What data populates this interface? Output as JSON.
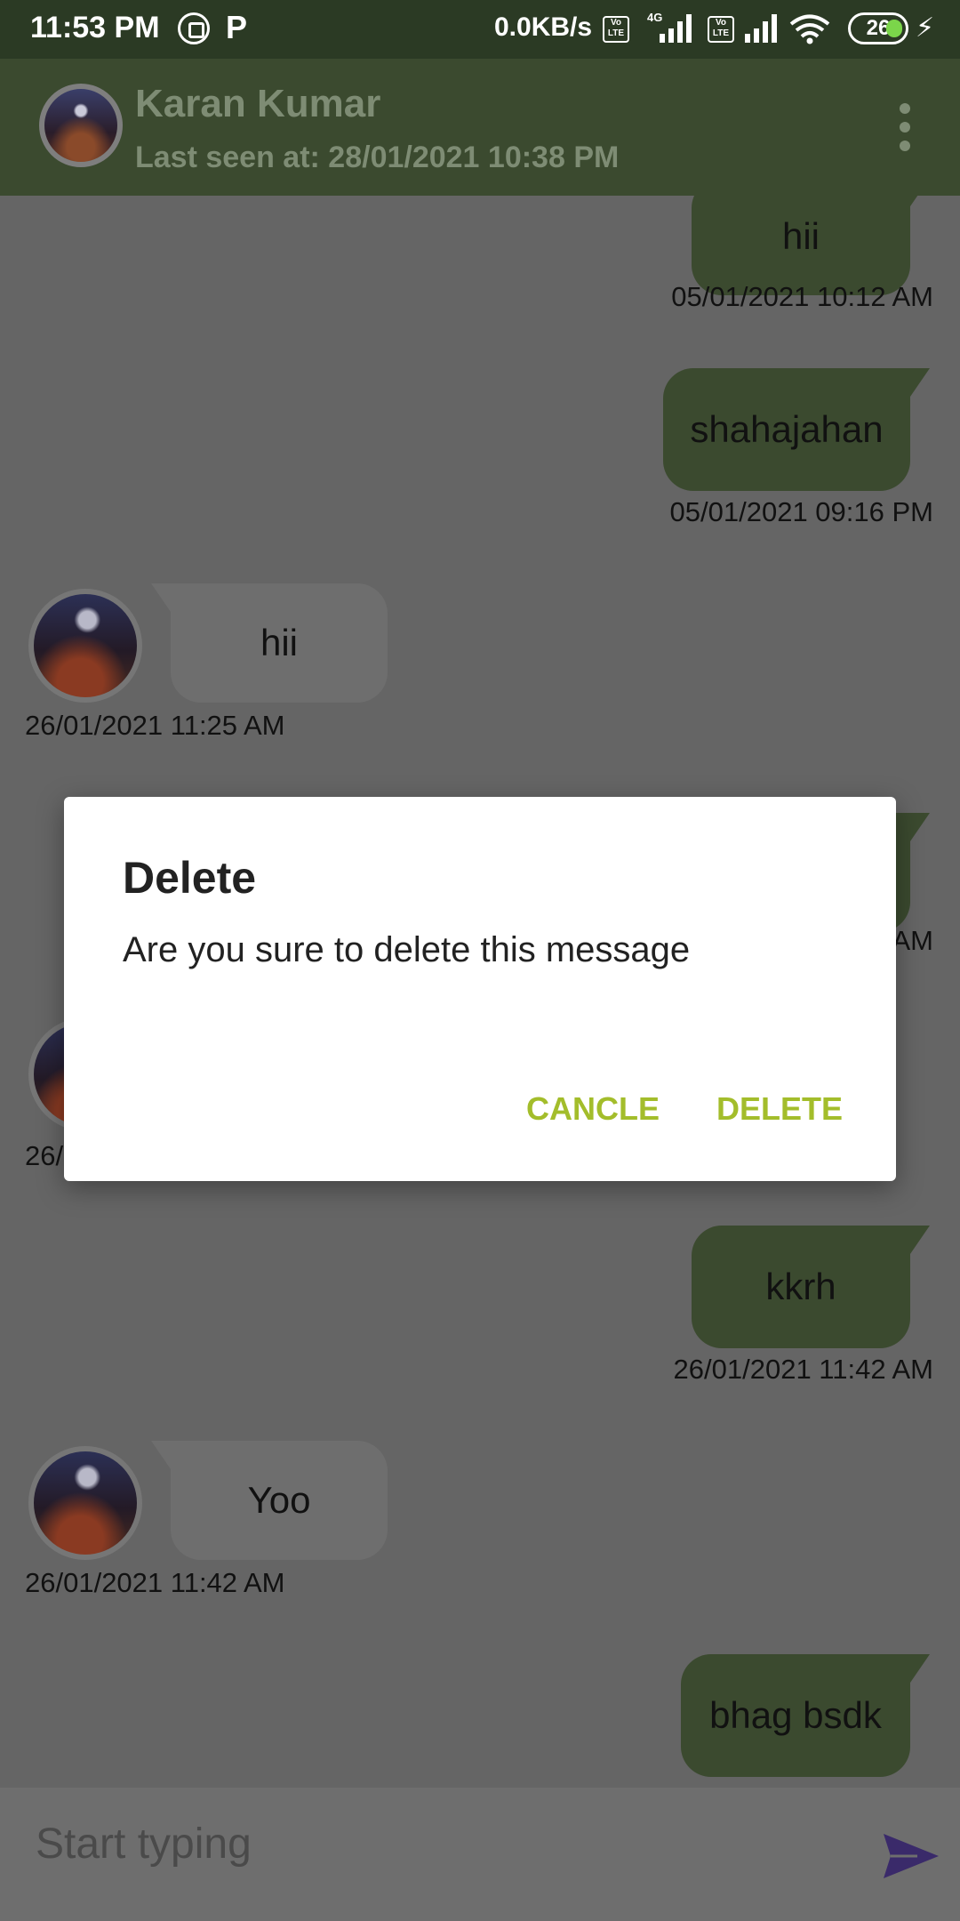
{
  "status_bar": {
    "time": "11:53 PM",
    "data_speed": "0.0KB/s",
    "network_type": "4G",
    "battery": "26"
  },
  "header": {
    "contact_name": "Karan Kumar",
    "last_seen": "Last seen at: 28/01/2021 10:38 PM"
  },
  "messages": [
    {
      "direction": "out",
      "text": "hii",
      "time": "05/01/2021 10:12 AM"
    },
    {
      "direction": "out",
      "text": "shahajahan",
      "time": "05/01/2021 09:16 PM"
    },
    {
      "direction": "in",
      "text": "hii",
      "time": "26/01/2021 11:25 AM"
    },
    {
      "direction": "out",
      "text": "",
      "time": "AM"
    },
    {
      "direction": "in",
      "text": "",
      "time": "26/"
    },
    {
      "direction": "out",
      "text": "kkrh",
      "time": "26/01/2021 11:42 AM"
    },
    {
      "direction": "in",
      "text": "Yoo",
      "time": "26/01/2021 11:42 AM"
    },
    {
      "direction": "out",
      "text": "bhag bsdk",
      "time": ""
    }
  ],
  "input": {
    "placeholder": "Start typing"
  },
  "dialog": {
    "title": "Delete",
    "message": "Are you sure to delete this message",
    "cancel_label": "CANCLE",
    "delete_label": "DELETE"
  },
  "colors": {
    "app_bar": "#3b4a2f",
    "status_bar": "#2b3a24",
    "dialog_accent": "#a3bd2b",
    "send_icon": "#3a2a6a"
  },
  "icons": [
    "whatsapp-icon",
    "p-icon",
    "signal-icon",
    "wifi-icon",
    "battery-icon",
    "charging-icon",
    "more-vert-icon",
    "send-icon"
  ]
}
